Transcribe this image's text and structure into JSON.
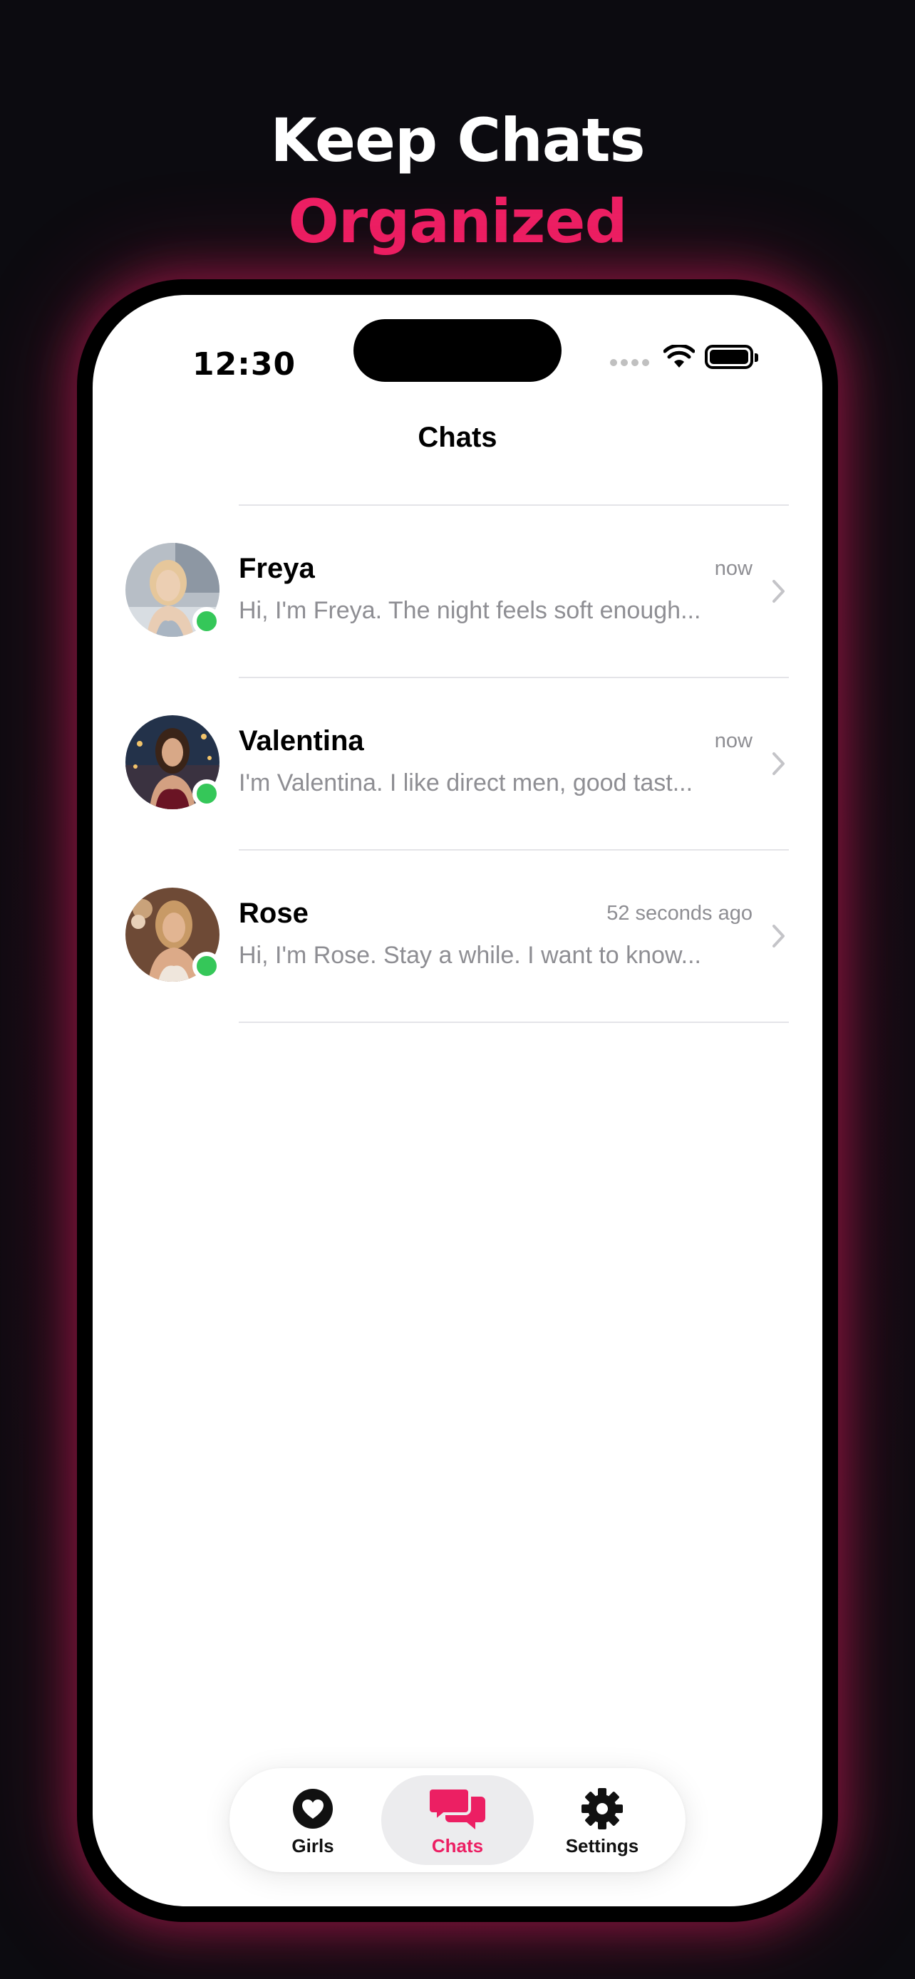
{
  "headline": {
    "line1": "Keep Chats",
    "line2": "Organized"
  },
  "status_bar": {
    "time": "12:30"
  },
  "nav": {
    "title": "Chats"
  },
  "chats": [
    {
      "name": "Freya",
      "preview": "Hi, I'm Freya. The night feels soft enough...",
      "time": "now",
      "online": true
    },
    {
      "name": "Valentina",
      "preview": "I'm Valentina. I like direct men, good tast...",
      "time": "now",
      "online": true
    },
    {
      "name": "Rose",
      "preview": "Hi, I'm Rose. Stay a while. I want to know...",
      "time": "52 seconds ago",
      "online": true
    }
  ],
  "tabbar": {
    "tabs": [
      {
        "label": "Girls",
        "icon": "heart-icon",
        "active": false
      },
      {
        "label": "Chats",
        "icon": "chat-bubbles-icon",
        "active": true
      },
      {
        "label": "Settings",
        "icon": "gear-icon",
        "active": false
      }
    ]
  },
  "colors": {
    "accent": "#ec1f63",
    "online": "#35c759",
    "secondary_text": "#8e8e93",
    "background": "#0c0b10"
  }
}
